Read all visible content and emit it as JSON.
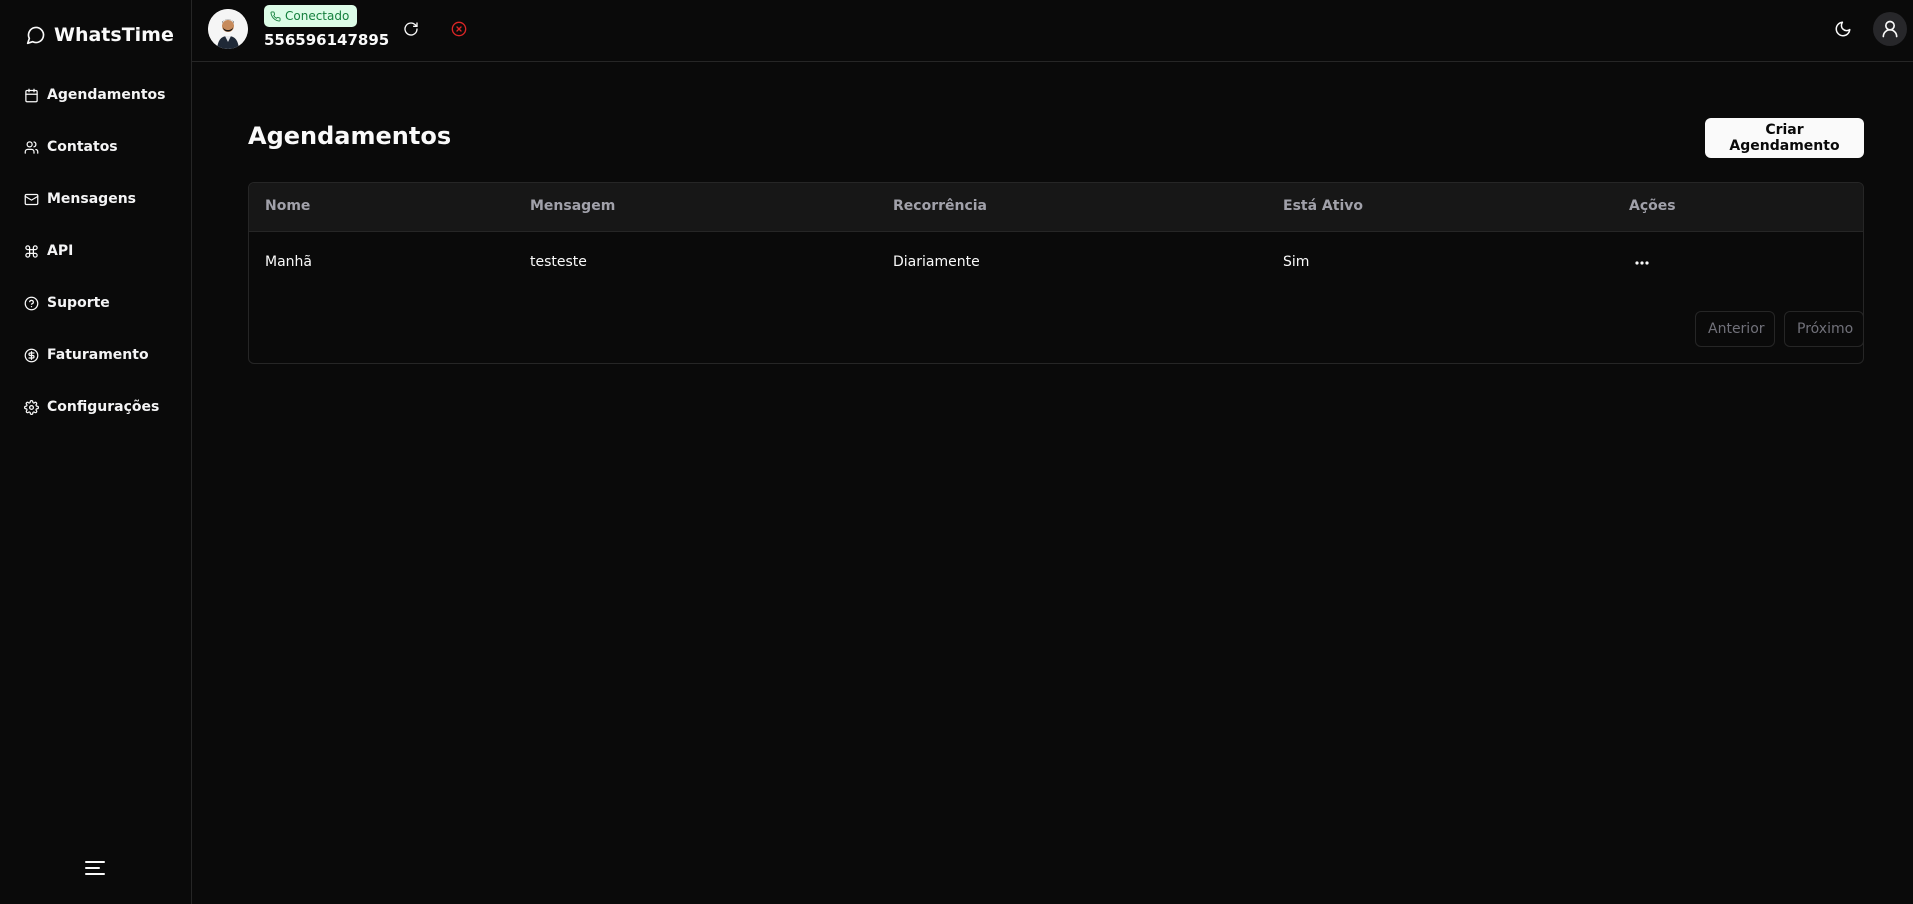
{
  "app": {
    "name": "WhatsTime"
  },
  "sidebar": {
    "items": [
      {
        "label": "Agendamentos",
        "icon": "calendar-icon"
      },
      {
        "label": "Contatos",
        "icon": "users-icon"
      },
      {
        "label": "Mensagens",
        "icon": "mail-icon"
      },
      {
        "label": "API",
        "icon": "command-icon"
      },
      {
        "label": "Suporte",
        "icon": "help-circle-icon"
      },
      {
        "label": "Faturamento",
        "icon": "dollar-circle-icon"
      },
      {
        "label": "Configurações",
        "icon": "gear-icon"
      }
    ]
  },
  "header": {
    "status": "Conectado",
    "phone": "556596147895"
  },
  "page": {
    "title": "Agendamentos",
    "create_label": "Criar Agendamento"
  },
  "table": {
    "columns": [
      "Nome",
      "Mensagem",
      "Recorrência",
      "Está Ativo",
      "Ações"
    ],
    "rows": [
      {
        "nome": "Manhã",
        "mensagem": "testeste",
        "recorrencia": "Diariamente",
        "ativo": "Sim"
      }
    ]
  },
  "pagination": {
    "prev_label": "Anterior",
    "next_label": "Próximo"
  },
  "colors": {
    "background": "#0a0a0a",
    "border": "#262626",
    "status_badge_bg": "#dcfce7",
    "status_badge_text": "#15803d",
    "disconnect": "#dc2626"
  }
}
